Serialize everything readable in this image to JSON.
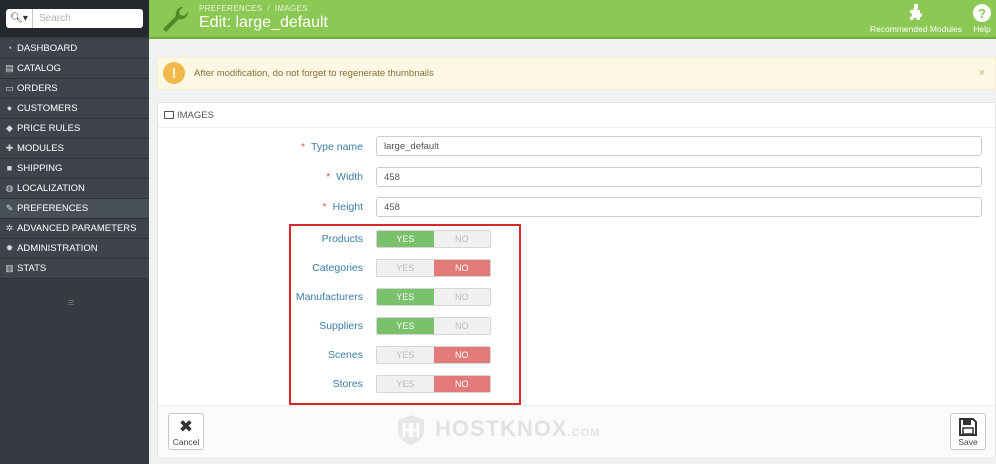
{
  "search": {
    "placeholder": "Search",
    "button_icon": "search-icon"
  },
  "sidebar": {
    "items": [
      {
        "label": "DASHBOARD",
        "icon": "dashboard-icon",
        "glyph": "◔"
      },
      {
        "label": "CATALOG",
        "icon": "catalog-icon",
        "glyph": "▤"
      },
      {
        "label": "ORDERS",
        "icon": "credit-card-icon",
        "glyph": "▭"
      },
      {
        "label": "CUSTOMERS",
        "icon": "users-icon",
        "glyph": "●"
      },
      {
        "label": "PRICE RULES",
        "icon": "tag-icon",
        "glyph": "◆"
      },
      {
        "label": "MODULES",
        "icon": "puzzle-icon",
        "glyph": "✚"
      },
      {
        "label": "SHIPPING",
        "icon": "truck-icon",
        "glyph": "■"
      },
      {
        "label": "LOCALIZATION",
        "icon": "globe-icon",
        "glyph": "◍"
      },
      {
        "label": "PREFERENCES",
        "icon": "wrench-icon",
        "glyph": "✎"
      },
      {
        "label": "ADVANCED PARAMETERS",
        "icon": "cogs-icon",
        "glyph": "✲"
      },
      {
        "label": "ADMINISTRATION",
        "icon": "gear-icon",
        "glyph": "✹"
      },
      {
        "label": "STATS",
        "icon": "bar-chart-icon",
        "glyph": "▥"
      }
    ],
    "collapse_glyph": "≡"
  },
  "header": {
    "breadcrumb": [
      "PREFERENCES",
      "IMAGES"
    ],
    "breadcrumb_sep": "/",
    "title": "Edit: large_default",
    "recommended_label": "Recommended Modules",
    "help_label": "Help",
    "accent": "#8bc954"
  },
  "alert": {
    "text": "After modification, do not forget to regenerate thumbnails",
    "icon_glyph": "!",
    "close_glyph": "×"
  },
  "panel": {
    "title": "IMAGES",
    "fields": {
      "type_name": {
        "label": "Type name",
        "value": "large_default"
      },
      "width": {
        "label": "Width",
        "value": "458"
      },
      "height": {
        "label": "Height",
        "value": "458"
      }
    },
    "required_mark": "*",
    "toggle_yes": "YES",
    "toggle_no": "NO",
    "toggles": [
      {
        "label": "Products",
        "value": "yes"
      },
      {
        "label": "Categories",
        "value": "no"
      },
      {
        "label": "Manufacturers",
        "value": "yes"
      },
      {
        "label": "Suppliers",
        "value": "yes"
      },
      {
        "label": "Scenes",
        "value": "no"
      },
      {
        "label": "Stores",
        "value": "no"
      }
    ],
    "cancel_label": "Cancel",
    "save_label": "Save",
    "cancel_glyph": "✖",
    "save_glyph": "💾"
  },
  "watermark": {
    "main": "HOSTKNOX",
    "suffix": ".COM"
  }
}
